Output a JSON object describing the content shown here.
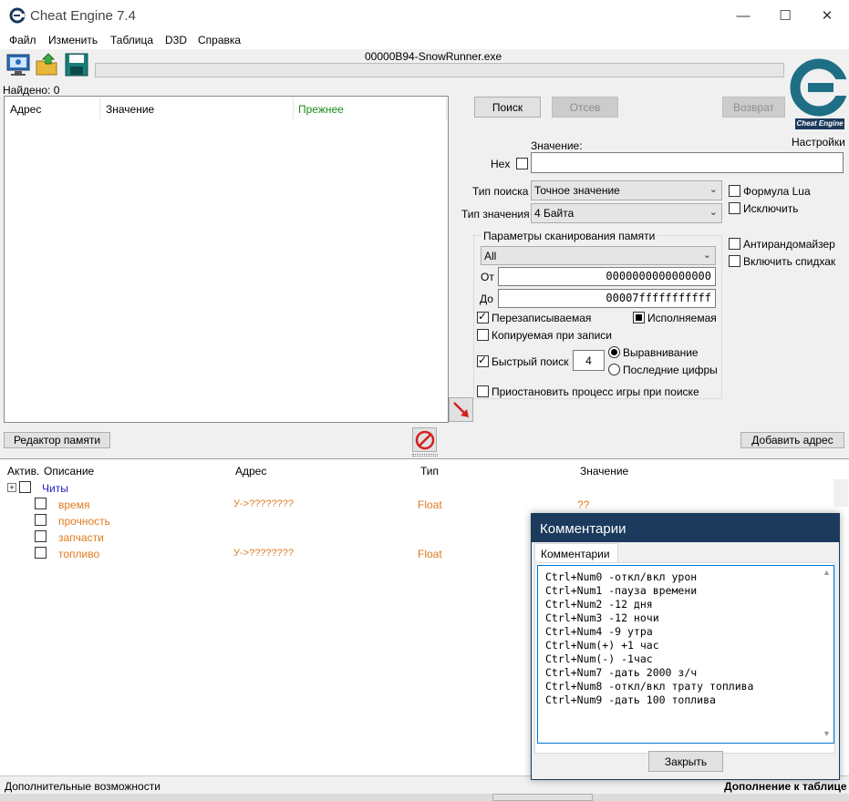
{
  "window": {
    "title": "Cheat Engine 7.4",
    "controls": {
      "minimize": "—",
      "maximize": "☐",
      "close": "✕"
    }
  },
  "menu": [
    "Файл",
    "Изменить",
    "Таблица",
    "D3D",
    "Справка"
  ],
  "toolbar": {
    "process": "00000B94-SnowRunner.exe",
    "icons": [
      "open-process-icon",
      "open-file-icon",
      "save-icon"
    ],
    "logo_text": "Cheat Engine"
  },
  "found_label": "Найдено: 0",
  "results": {
    "columns": {
      "address": "Адрес",
      "value": "Значение",
      "previous": "Прежнее"
    }
  },
  "scan": {
    "search_btn": "Поиск",
    "undo_btn": "Отсев",
    "back_btn": "Возврат",
    "settings_link": "Настройки",
    "value_label": "Значение:",
    "hex_label": "Hex",
    "hex_checked": false,
    "value_input": "",
    "scan_type_label": "Тип поиска",
    "scan_type_value": "Точное значение",
    "value_type_label": "Тип значения",
    "value_type_value": "4 Байта",
    "lua_formula": "Формула Lua",
    "exclude": "Исключить",
    "antirandom": "Антирандомайзер",
    "speedhack": "Включить спидхак",
    "mem_group_label": "Параметры сканирования памяти",
    "mem_region": "All",
    "from_label": "От",
    "from_value": "0000000000000000",
    "to_label": "До",
    "to_value": "00007fffffffffff",
    "writable": "Перезаписываемая",
    "executable": "Исполняемая",
    "copy_on_write": "Копируемая при записи",
    "fast_scan": "Быстрый поиск",
    "fast_scan_value": "4",
    "alignment": "Выравнивание",
    "last_digits": "Последние цифры",
    "pause_game": "Приостановить процесс игры при поиске"
  },
  "mid_toolbar": {
    "memory_view_btn": "Редактор памяти",
    "add_address_btn": "Добавить адрес"
  },
  "table": {
    "columns": {
      "active": "Актив.",
      "description": "Описание",
      "address": "Адрес",
      "type": "Тип",
      "value": "Значение"
    },
    "group": {
      "expand": "+",
      "name": "Читы"
    },
    "rows": [
      {
        "desc": "время",
        "address": "У->????????",
        "type": "Float",
        "value": "??"
      },
      {
        "desc": "прочность",
        "address": "",
        "type": "",
        "value": ""
      },
      {
        "desc": "запчасти",
        "address": "",
        "type": "",
        "value": ""
      },
      {
        "desc": "топливо",
        "address": "У->????????",
        "type": "Float",
        "value": ""
      }
    ]
  },
  "statusbar": {
    "left": "Дополнительные возможности",
    "right": "Дополнение к таблице"
  },
  "comments_dialog": {
    "title": "Комментарии",
    "tab": "Комментарии",
    "lines": [
      "Ctrl+Num0 -откл/вкл урон",
      "Ctrl+Num1 -пауза времени",
      "Ctrl+Num2 -12 дня",
      "Ctrl+Num3 -12 ночи",
      "Ctrl+Num4 -9 утра",
      "Ctrl+Num(+) +1 час",
      "Ctrl+Num(-) -1час",
      "Ctrl+Num7 -дать 2000 з/ч",
      "Ctrl+Num8 -откл/вкл трату топлива",
      "Ctrl+Num9 -дать 100 топлива"
    ],
    "close_btn": "Закрыть",
    "hidden_btn_fragment": "Закрыть"
  },
  "colors": {
    "accent": "#1b3a5c",
    "orange_entry": "#e07a1f",
    "group_text": "#1e1ebe",
    "prev_column": "#1a8a1a"
  }
}
